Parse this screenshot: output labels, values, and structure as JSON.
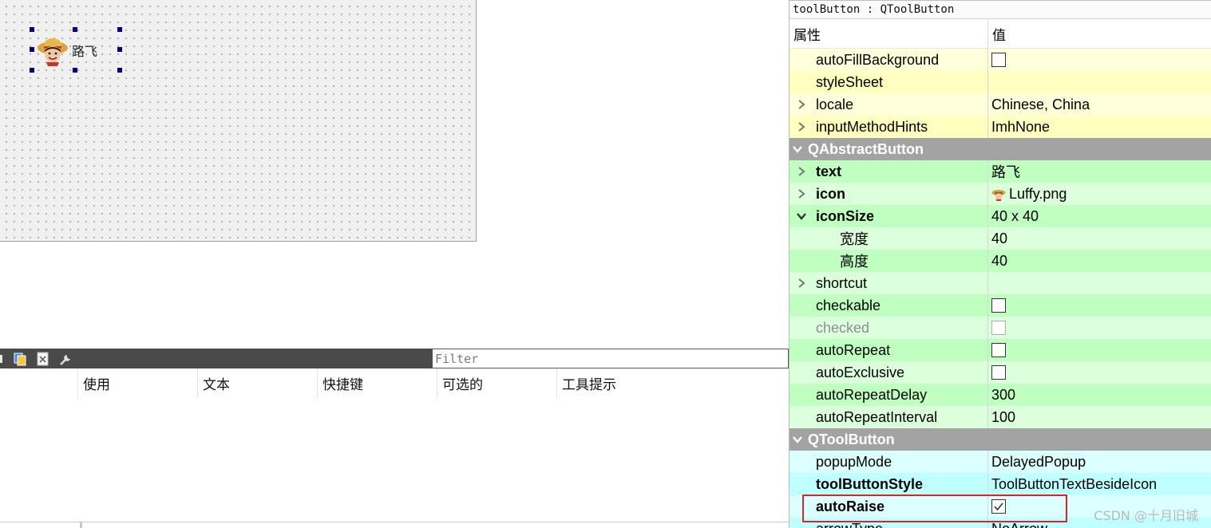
{
  "canvas": {
    "tool_button": {
      "text": "路飞"
    }
  },
  "action_editor": {
    "filter": {
      "placeholder": "Filter"
    },
    "columns": [
      "",
      "使用",
      "文本",
      "快捷键",
      "可选的",
      "工具提示"
    ],
    "toolbar_icons": [
      "new-action-icon",
      "copy-icon",
      "delete-icon",
      "configure-icon"
    ]
  },
  "property_editor": {
    "object_title": "toolButton : QToolButton",
    "header": {
      "name": "属性",
      "value": "值"
    },
    "rows": [
      {
        "kind": "prop",
        "name": "autoFillBackground",
        "value": "",
        "checkbox": "unchecked",
        "expander": "none",
        "shade": "y1"
      },
      {
        "kind": "prop",
        "name": "styleSheet",
        "value": "",
        "expander": "none",
        "shade": "y2"
      },
      {
        "kind": "prop",
        "name": "locale",
        "value": "Chinese, China",
        "expander": "collapsed",
        "shade": "y1"
      },
      {
        "kind": "prop",
        "name": "inputMethodHints",
        "value": "ImhNone",
        "expander": "collapsed",
        "shade": "y2"
      },
      {
        "kind": "group",
        "name": "QAbstractButton"
      },
      {
        "kind": "prop",
        "name": "text",
        "value": "路飞",
        "bold": true,
        "expander": "collapsed",
        "shade": "g2"
      },
      {
        "kind": "prop",
        "name": "icon",
        "value": "Luffy.png",
        "icon": "luffy-icon",
        "bold": true,
        "expander": "collapsed",
        "shade": "g1"
      },
      {
        "kind": "prop",
        "name": "iconSize",
        "value": "40 x 40",
        "bold": true,
        "expander": "expanded",
        "shade": "g2"
      },
      {
        "kind": "sub",
        "name": "宽度",
        "value": "40",
        "shade": "g1"
      },
      {
        "kind": "sub",
        "name": "高度",
        "value": "40",
        "shade": "g2"
      },
      {
        "kind": "prop",
        "name": "shortcut",
        "value": "",
        "expander": "collapsed",
        "shade": "g1"
      },
      {
        "kind": "prop",
        "name": "checkable",
        "value": "",
        "checkbox": "unchecked",
        "expander": "none",
        "shade": "g2"
      },
      {
        "kind": "prop",
        "name": "checked",
        "value": "",
        "checkbox": "disabled",
        "disabled": true,
        "expander": "none",
        "shade": "g1"
      },
      {
        "kind": "prop",
        "name": "autoRepeat",
        "value": "",
        "checkbox": "unchecked",
        "expander": "none",
        "shade": "g2"
      },
      {
        "kind": "prop",
        "name": "autoExclusive",
        "value": "",
        "checkbox": "unchecked",
        "expander": "none",
        "shade": "g1"
      },
      {
        "kind": "prop",
        "name": "autoRepeatDelay",
        "value": "300",
        "expander": "none",
        "shade": "g2"
      },
      {
        "kind": "prop",
        "name": "autoRepeatInterval",
        "value": "100",
        "expander": "none",
        "shade": "g1"
      },
      {
        "kind": "group",
        "name": "QToolButton"
      },
      {
        "kind": "prop",
        "name": "popupMode",
        "value": "DelayedPopup",
        "expander": "none",
        "shade": "c1"
      },
      {
        "kind": "prop",
        "name": "toolButtonStyle",
        "value": "ToolButtonTextBesideIcon",
        "bold": true,
        "expander": "none",
        "shade": "c2"
      },
      {
        "kind": "prop",
        "name": "autoRaise",
        "value": "",
        "checkbox": "checked",
        "bold": true,
        "expander": "none",
        "shade": "c1"
      },
      {
        "kind": "prop",
        "name": "arrowType",
        "value": "NoArrow",
        "expander": "none",
        "shade": "c2"
      }
    ]
  },
  "watermark": "CSDN @十月旧城",
  "colors": {
    "selection_handle": "#00007f",
    "highlight_box": "#e0202a",
    "group_header": "#a3a3a3"
  }
}
